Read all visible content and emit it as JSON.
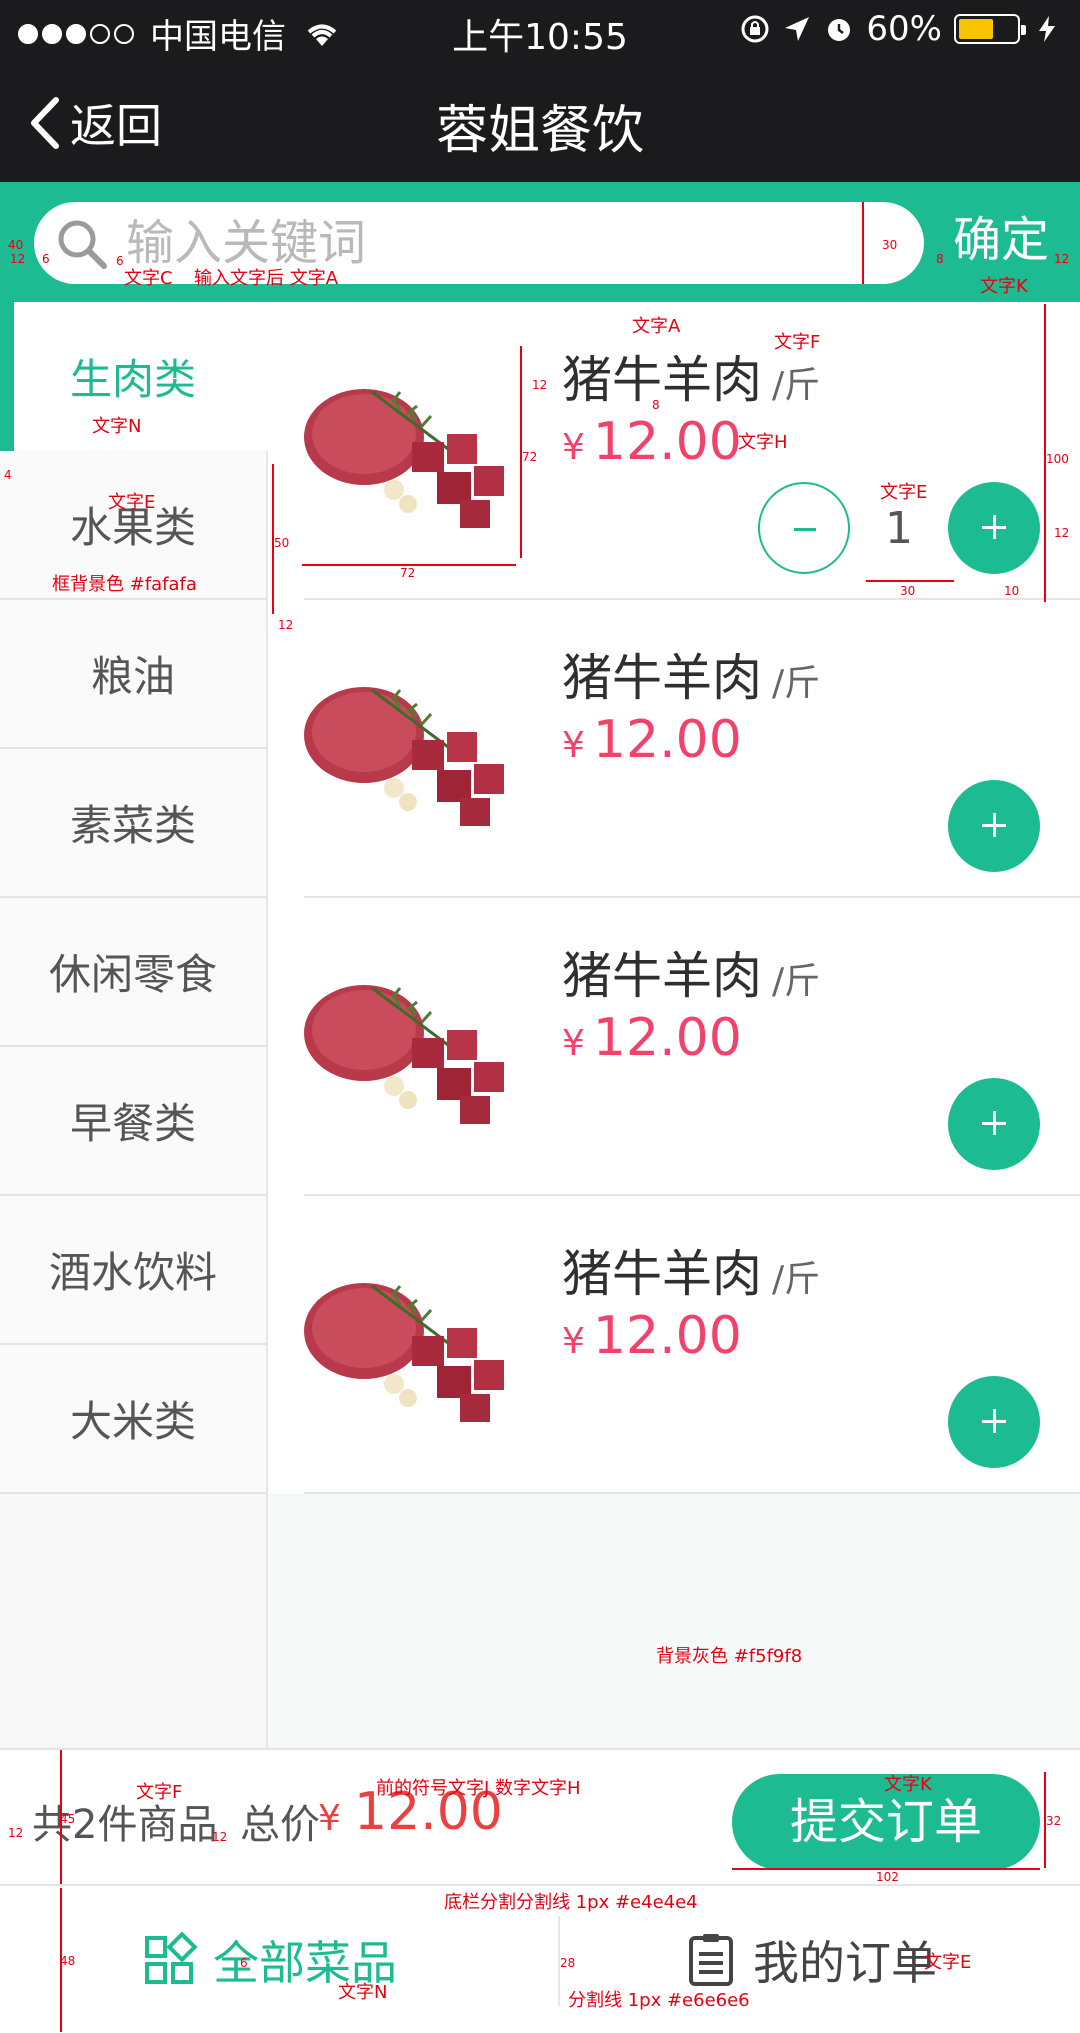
{
  "status_bar": {
    "carrier": "中国电信",
    "time": "上午10:55",
    "battery": "60%",
    "battery_level": 0.6
  },
  "nav": {
    "back_label": "返回",
    "title": "蓉姐餐饮"
  },
  "search": {
    "placeholder": "输入关键词",
    "confirm_label": "确定"
  },
  "sidebar": {
    "items": [
      {
        "label": "生肉类",
        "active": true
      },
      {
        "label": "水果类"
      },
      {
        "label": "粮油"
      },
      {
        "label": "素菜类"
      },
      {
        "label": "休闲零食"
      },
      {
        "label": "早餐类"
      },
      {
        "label": "酒水饮料"
      },
      {
        "label": "大米类"
      }
    ]
  },
  "products": [
    {
      "name": "猪牛羊肉",
      "unit": "/斤",
      "currency": "¥",
      "price": "12.00",
      "quantity": "1"
    },
    {
      "name": "猪牛羊肉",
      "unit": "/斤",
      "currency": "¥",
      "price": "12.00"
    },
    {
      "name": "猪牛羊肉",
      "unit": "/斤",
      "currency": "¥",
      "price": "12.00"
    },
    {
      "name": "猪牛羊肉",
      "unit": "/斤",
      "currency": "¥",
      "price": "12.00"
    }
  ],
  "annotations": {
    "search_text_c": "文字C",
    "search_after_input": "输入文字后 文字A",
    "confirm_text_k": "文字K",
    "product_name_a": "文字A",
    "unit_f": "文字F",
    "price_h": "文字H",
    "quantity_e": "文字E",
    "active_cat_n": "文字N",
    "cat_e": "文字E",
    "cat_bg": "框背景色 #fafafa",
    "bg_gray": "背景灰色 #f5f9f8",
    "count_f": "文字F",
    "price_j_h": "前的符号文字J  数字文字H",
    "submit_k": "文字K",
    "divider_line": "底栏分割分割线 1px  #e4e4e4",
    "tab_divider": "分割线 1px  #e6e6e6",
    "tab_left_n": "文字N",
    "tab_right_e": "文字E",
    "d40": "40",
    "d12": "12",
    "d6": "6",
    "d30": "30",
    "d8": "8",
    "d72": "72",
    "d50": "50",
    "d100": "100",
    "d10": "10",
    "d32": "32",
    "d102": "102",
    "d45": "45",
    "d48": "48",
    "d28": "28",
    "d4": "4"
  },
  "footer": {
    "count_text": "共2件商品",
    "total_label": "总价",
    "currency": "¥",
    "total": "12.00",
    "submit_label": "提交订单"
  },
  "tabbar": {
    "left_label": "全部菜品",
    "right_label": "我的订单"
  },
  "colors": {
    "brand_green": "#1dbb91",
    "price_red": "#f2416a",
    "sidebar_bg": "#fafafa",
    "page_bg": "#f5f9f8",
    "divider": "#e4e4e4",
    "tab_divider": "#e6e6e6"
  }
}
